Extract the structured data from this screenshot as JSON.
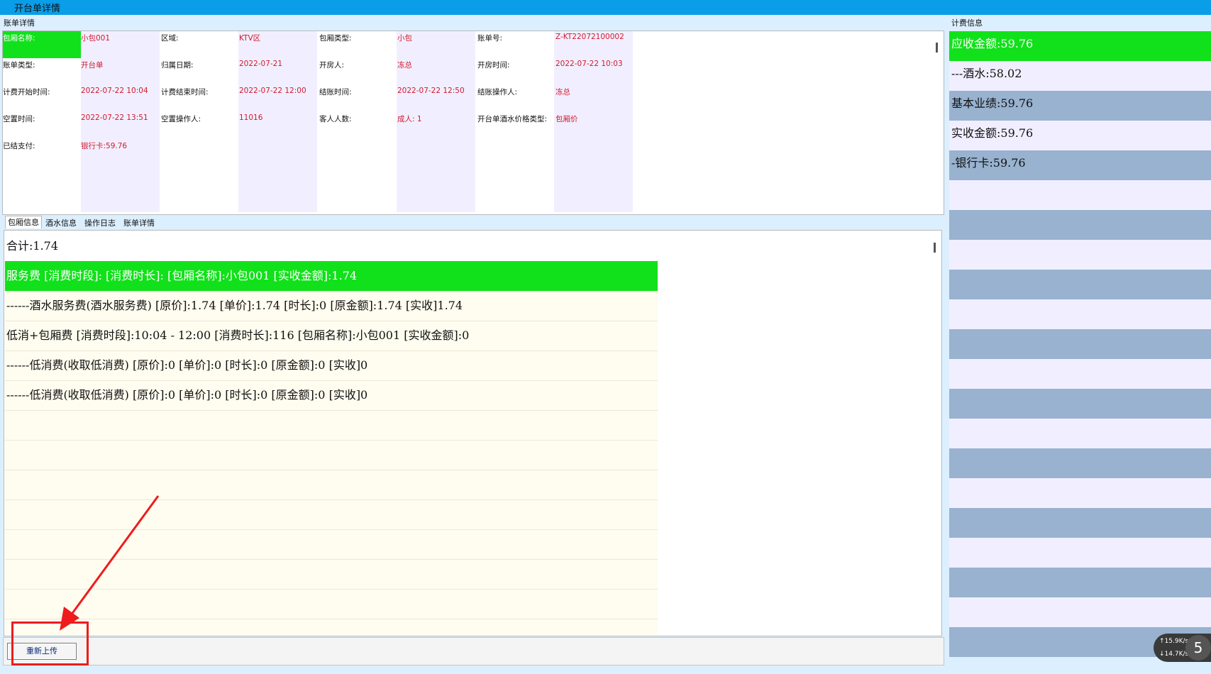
{
  "window": {
    "title": "开台单详情"
  },
  "bill_detail": {
    "section_label": "账单详情",
    "fields": [
      {
        "label": "包厢名称:",
        "value": "小包001"
      },
      {
        "label": "区域:",
        "value": "KTV区"
      },
      {
        "label": "包厢类型:",
        "value": "小包"
      },
      {
        "label": "账单号:",
        "value": "Z-KT22072100002"
      },
      {
        "label": "账单类型:",
        "value": "开台单"
      },
      {
        "label": "归属日期:",
        "value": "2022-07-21"
      },
      {
        "label": "开房人:",
        "value": "冻总"
      },
      {
        "label": "开房时间:",
        "value": "2022-07-22 10:03"
      },
      {
        "label": "计费开始时间:",
        "value": "2022-07-22 10:04"
      },
      {
        "label": "计费结束时间:",
        "value": "2022-07-22 12:00"
      },
      {
        "label": "结账时间:",
        "value": "2022-07-22 12:50"
      },
      {
        "label": "结账操作人:",
        "value": "冻总"
      },
      {
        "label": "空置时间:",
        "value": "2022-07-22 13:51"
      },
      {
        "label": "空置操作人:",
        "value": "11016"
      },
      {
        "label": "客人人数:",
        "value": "成人: 1"
      },
      {
        "label": "开台单酒水价格类型:",
        "value": "包厢价"
      },
      {
        "label": "已结支付:",
        "value": "银行卡:59.76"
      }
    ]
  },
  "tabs": [
    "包厢信息",
    "酒水信息",
    "操作日志",
    "账单详情"
  ],
  "detail_rows": [
    "合计:1.74",
    "服务费 [消费时段]: [消费时长]: [包厢名称]:小包001 [实收金额]:1.74",
    "------酒水服务费(酒水服务费) [原价]:1.74 [单价]:1.74 [时长]:0 [原金额]:1.74 [实收]1.74",
    "低消+包厢费 [消费时段]:10:04 - 12:00 [消费时长]:116 [包厢名称]:小包001 [实收金额]:0",
    "------低消费(收取低消费) [原价]:0 [单价]:0 [时长]:0 [原金额]:0 [实收]0",
    "------低消费(收取低消费) [原价]:0 [单价]:0 [时长]:0 [原金额]:0 [实收]0"
  ],
  "reupload_button": "重新上传",
  "fee_info": {
    "section_label": "计费信息",
    "rows": [
      "应收金额:59.76",
      "---酒水:58.02",
      "基本业绩:59.76",
      "实收金额:59.76",
      "-银行卡:59.76"
    ]
  },
  "network_widget": {
    "up": "↑15.9K/s",
    "down": "↓14.7K/s",
    "badge": "5"
  },
  "colors": {
    "title_bar": "#0a9de8",
    "highlight_green": "#11e11a",
    "value_red": "#d01a2d",
    "stripe_blue": "#98b2cf"
  }
}
